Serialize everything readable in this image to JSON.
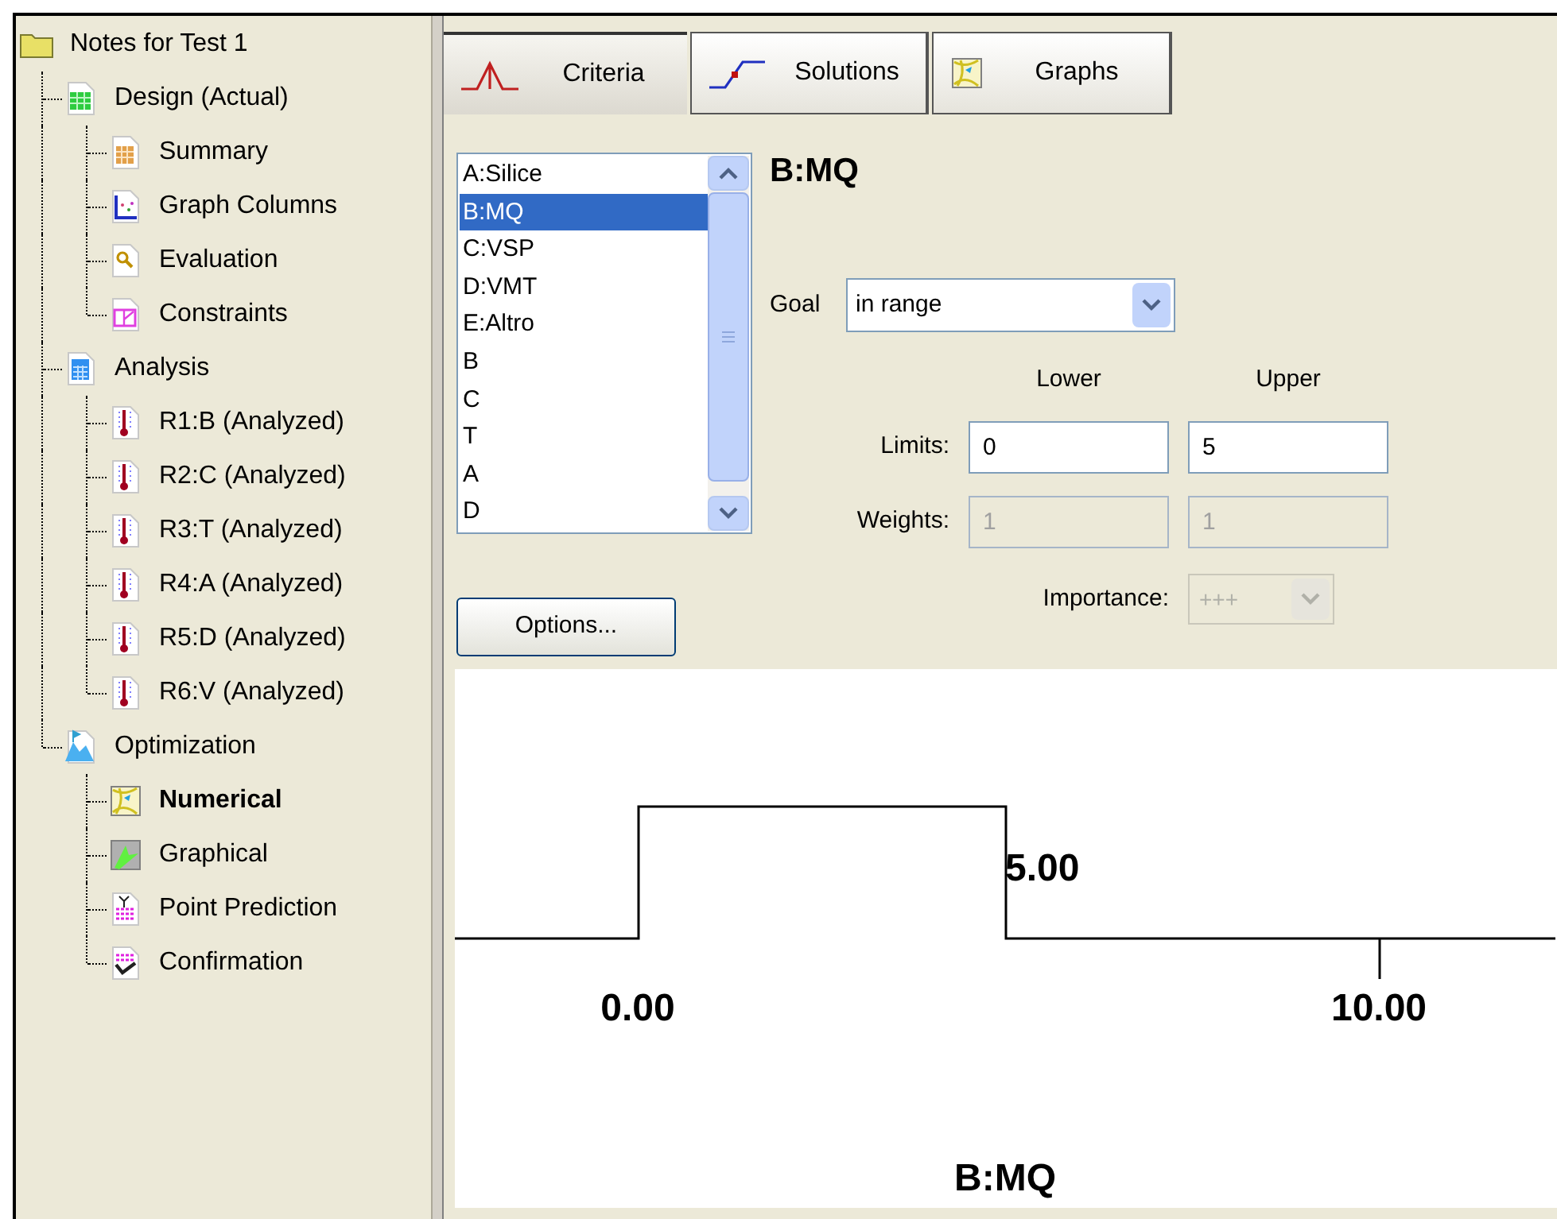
{
  "tree": {
    "label": "Notes for Test 1",
    "kind": "folder",
    "selected": false,
    "children": [
      {
        "label": "Design (Actual)",
        "kind": "grid",
        "selected": false,
        "children": [
          {
            "label": "Summary",
            "kind": "table",
            "selected": false
          },
          {
            "label": "Graph Columns",
            "kind": "scatter",
            "selected": false
          },
          {
            "label": "Evaluation",
            "kind": "magnifier",
            "selected": false
          },
          {
            "label": "Constraints",
            "kind": "constraints",
            "selected": false
          }
        ]
      },
      {
        "label": "Analysis",
        "kind": "calculator",
        "selected": false,
        "children": [
          {
            "label": "R1:B (Analyzed)",
            "kind": "thermometer",
            "selected": false
          },
          {
            "label": "R2:C (Analyzed)",
            "kind": "thermometer",
            "selected": false
          },
          {
            "label": "R3:T (Analyzed)",
            "kind": "thermometer",
            "selected": false
          },
          {
            "label": "R4:A (Analyzed)",
            "kind": "thermometer",
            "selected": false
          },
          {
            "label": "R5:D (Analyzed)",
            "kind": "thermometer",
            "selected": false
          },
          {
            "label": "R6:V (Analyzed)",
            "kind": "thermometer",
            "selected": false
          }
        ]
      },
      {
        "label": "Optimization",
        "kind": "mountain",
        "selected": false,
        "children": [
          {
            "label": "Numerical",
            "kind": "map",
            "selected": true
          },
          {
            "label": "Graphical",
            "kind": "region",
            "selected": false
          },
          {
            "label": "Point Prediction",
            "kind": "prediction",
            "selected": false
          },
          {
            "label": "Confirmation",
            "kind": "confirmation",
            "selected": false
          }
        ]
      }
    ]
  },
  "tabs": [
    {
      "label": "Criteria",
      "kind": "peak",
      "selected": true
    },
    {
      "label": "Solutions",
      "kind": "ramp",
      "selected": false
    },
    {
      "label": "Graphs",
      "kind": "map",
      "selected": false
    }
  ],
  "variables": [
    {
      "label": "A:Silice",
      "selected": false
    },
    {
      "label": "B:MQ",
      "selected": true
    },
    {
      "label": "C:VSP",
      "selected": false
    },
    {
      "label": "D:VMT",
      "selected": false
    },
    {
      "label": "E:Altro",
      "selected": false
    },
    {
      "label": "B",
      "selected": false
    },
    {
      "label": "C",
      "selected": false
    },
    {
      "label": "T",
      "selected": false
    },
    {
      "label": "A",
      "selected": false
    },
    {
      "label": "D",
      "selected": false
    }
  ],
  "options_button": "Options...",
  "heading": "B:MQ",
  "goal": {
    "label": "Goal",
    "value": "in range"
  },
  "columns": [
    "Lower",
    "Upper"
  ],
  "rows": [
    {
      "label": "Limits:",
      "values": [
        "0",
        "5"
      ],
      "disabled": false
    },
    {
      "label": "Weights:",
      "values": [
        "1",
        "1"
      ],
      "disabled": true
    }
  ],
  "importance": {
    "label": "Importance:",
    "value": "+++",
    "disabled": true
  },
  "plot": {
    "tick_labels": [
      "0.00",
      "10.00"
    ],
    "limit_label": "5.00",
    "title": "B:MQ"
  }
}
